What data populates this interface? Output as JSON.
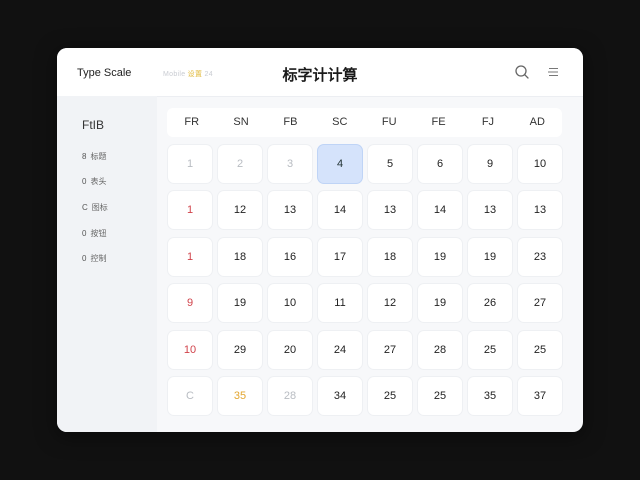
{
  "header": {
    "app_title": "Type Scale",
    "faint_text_pre": "Mobile ",
    "faint_text_highlight": "设置",
    "faint_text_post": " 24",
    "page_title": "标字计计算"
  },
  "sidebar": {
    "heading": "FtIB",
    "items": [
      {
        "marker": "8",
        "label": "标题"
      },
      {
        "marker": "0",
        "label": "表头"
      },
      {
        "marker": "C",
        "label": "图标"
      },
      {
        "marker": "0",
        "label": "按钮"
      },
      {
        "marker": "0",
        "label": "控制"
      }
    ]
  },
  "grid": {
    "columns": [
      "FR",
      "SN",
      "FB",
      "SC",
      "FU",
      "FE",
      "FJ",
      "AD"
    ],
    "rows": [
      [
        {
          "v": "1",
          "s": "muted"
        },
        {
          "v": "2",
          "s": "muted"
        },
        {
          "v": "3",
          "s": "muted"
        },
        {
          "v": "4",
          "s": "selected"
        },
        {
          "v": "5",
          "s": ""
        },
        {
          "v": "6",
          "s": ""
        },
        {
          "v": "9",
          "s": ""
        },
        {
          "v": "10",
          "s": ""
        }
      ],
      [
        {
          "v": "1",
          "s": "red"
        },
        {
          "v": "12",
          "s": ""
        },
        {
          "v": "13",
          "s": ""
        },
        {
          "v": "14",
          "s": ""
        },
        {
          "v": "13",
          "s": ""
        },
        {
          "v": "14",
          "s": ""
        },
        {
          "v": "13",
          "s": ""
        },
        {
          "v": "13",
          "s": ""
        }
      ],
      [
        {
          "v": "1",
          "s": "red"
        },
        {
          "v": "18",
          "s": ""
        },
        {
          "v": "16",
          "s": ""
        },
        {
          "v": "17",
          "s": ""
        },
        {
          "v": "18",
          "s": ""
        },
        {
          "v": "19",
          "s": ""
        },
        {
          "v": "19",
          "s": ""
        },
        {
          "v": "23",
          "s": ""
        }
      ],
      [
        {
          "v": "9",
          "s": "red"
        },
        {
          "v": "19",
          "s": ""
        },
        {
          "v": "10",
          "s": ""
        },
        {
          "v": "11",
          "s": ""
        },
        {
          "v": "12",
          "s": ""
        },
        {
          "v": "19",
          "s": ""
        },
        {
          "v": "26",
          "s": ""
        },
        {
          "v": "27",
          "s": ""
        }
      ],
      [
        {
          "v": "10",
          "s": "red"
        },
        {
          "v": "29",
          "s": ""
        },
        {
          "v": "20",
          "s": ""
        },
        {
          "v": "24",
          "s": ""
        },
        {
          "v": "27",
          "s": ""
        },
        {
          "v": "28",
          "s": ""
        },
        {
          "v": "25",
          "s": ""
        },
        {
          "v": "25",
          "s": ""
        }
      ],
      [
        {
          "v": "C",
          "s": "muted"
        },
        {
          "v": "35",
          "s": "orange"
        },
        {
          "v": "28",
          "s": "muted"
        },
        {
          "v": "34",
          "s": ""
        },
        {
          "v": "25",
          "s": ""
        },
        {
          "v": "25",
          "s": ""
        },
        {
          "v": "35",
          "s": ""
        },
        {
          "v": "37",
          "s": ""
        }
      ]
    ]
  },
  "icons": {
    "search": "search-icon",
    "menu": "menu-icon"
  },
  "colors": {
    "selected_cell": "#d5e3fb",
    "accent_red": "#d0424a",
    "accent_orange": "#e3a62f",
    "muted": "#b8bcc2"
  }
}
